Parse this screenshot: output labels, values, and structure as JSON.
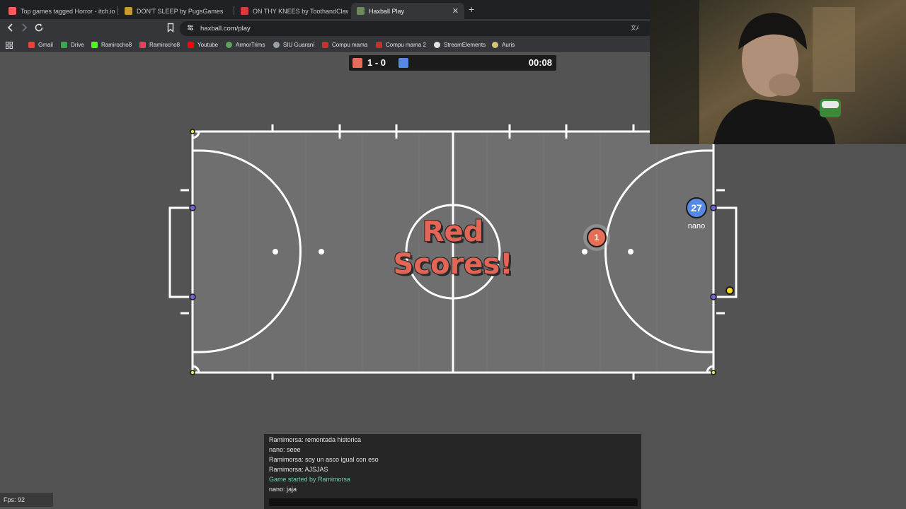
{
  "browser": {
    "tabs": [
      {
        "label": "Top games tagged Horror - itch.io",
        "favicon_color": "#fa5c5c"
      },
      {
        "label": "DON'T SLEEP by PugsGames",
        "favicon_color": "#c99a2e"
      },
      {
        "label": "ON THY KNEES by ToothandClaw",
        "favicon_color": "#d93a3a"
      },
      {
        "label": "Haxball Play",
        "favicon_color": "#6c8a5a"
      }
    ],
    "active_tab_close": "✕",
    "new_tab": "+",
    "url": "haxball.com/play",
    "bookmarks": [
      {
        "label": "Gmail",
        "icon_color": "#ea4335"
      },
      {
        "label": "Drive",
        "icon_color": "#34a853"
      },
      {
        "label": "Ramirocho8",
        "icon_color": "#53fc18"
      },
      {
        "label": "Ramirocho8",
        "icon_color": "#e4405f"
      },
      {
        "label": "Youtube",
        "icon_color": "#ff0000"
      },
      {
        "label": "ArmorTrims",
        "icon_color": "#5ca45c"
      },
      {
        "label": "SIU Guaraní",
        "icon_color": "#9aa0a6"
      },
      {
        "label": "Compu mama",
        "icon_color": "#c53030"
      },
      {
        "label": "Compu mama 2",
        "icon_color": "#c53030"
      },
      {
        "label": "StreamElements",
        "icon_color": "#e3e3e3"
      },
      {
        "label": "Auris",
        "icon_color": "#d6c37a"
      }
    ]
  },
  "scoreboard": {
    "red_color": "#e56e56",
    "blue_color": "#5689e5",
    "score": "1 - 0",
    "time": "00:08"
  },
  "game": {
    "goal_message_line1": "Red",
    "goal_message_line2": "Scores!",
    "red_player_number": "1",
    "blue_player_number": "27",
    "blue_player_name": "nano",
    "ball_color": "#f2d91e"
  },
  "chat": {
    "lines": [
      {
        "text": "Ramimorsa: remontada historica",
        "system": false
      },
      {
        "text": "nano: seee",
        "system": false
      },
      {
        "text": "Ramimorsa: soy un asco igual con eso",
        "system": false
      },
      {
        "text": "Ramimorsa: AJSJAS",
        "system": false
      },
      {
        "text": "Game started by Ramimorsa",
        "system": true
      },
      {
        "text": "nano: jaja",
        "system": false
      }
    ]
  },
  "fps": "Fps: 92"
}
